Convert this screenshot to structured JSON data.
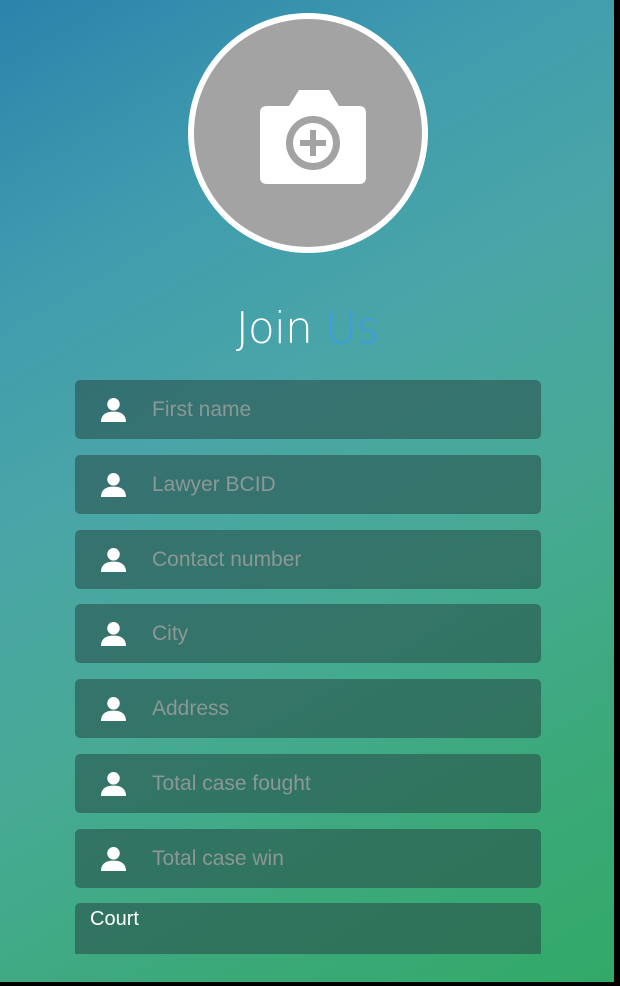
{
  "photo": {
    "icon": "camera-add-icon"
  },
  "title": {
    "part1": "Join",
    "part2": "Us"
  },
  "fields": [
    {
      "icon": "user-icon",
      "placeholder": "First name"
    },
    {
      "icon": "user-icon",
      "placeholder": "Lawyer BCID"
    },
    {
      "icon": "user-icon",
      "placeholder": "Contact number"
    },
    {
      "icon": "user-icon",
      "placeholder": "City"
    },
    {
      "icon": "user-icon",
      "placeholder": "Address"
    },
    {
      "icon": "user-icon",
      "placeholder": "Total case fought"
    },
    {
      "icon": "user-icon",
      "placeholder": "Total case win"
    }
  ],
  "court": {
    "label": "Court"
  },
  "colors": {
    "accent": "#3d9ce6",
    "avatar_bg": "#a3a3a3",
    "field_bg": "#264846"
  }
}
